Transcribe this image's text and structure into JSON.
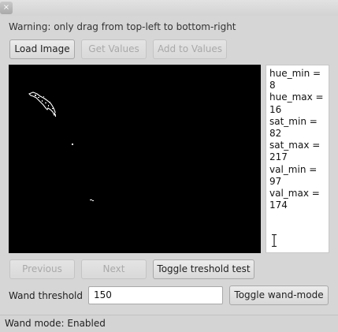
{
  "window": {
    "close_glyph": "×"
  },
  "warning_text": "Warning: only drag from top-left to bottom-right",
  "toolbar": {
    "load_image": "Load Image",
    "get_values": "Get Values",
    "add_to_values": "Add to Values"
  },
  "values_panel": {
    "lines": [
      "hue_min = 8",
      "hue_max =",
      "16",
      "sat_min =",
      "82",
      "sat_max =",
      "217",
      "val_min = 97",
      "val_max =",
      "174"
    ]
  },
  "navigation": {
    "previous": "Previous",
    "next": "Next",
    "toggle_threshold": "Toggle treshold test"
  },
  "wand": {
    "label": "Wand threshold",
    "value": "150",
    "toggle_mode": "Toggle wand-mode"
  },
  "status": {
    "text": "Wand mode: Enabled"
  }
}
